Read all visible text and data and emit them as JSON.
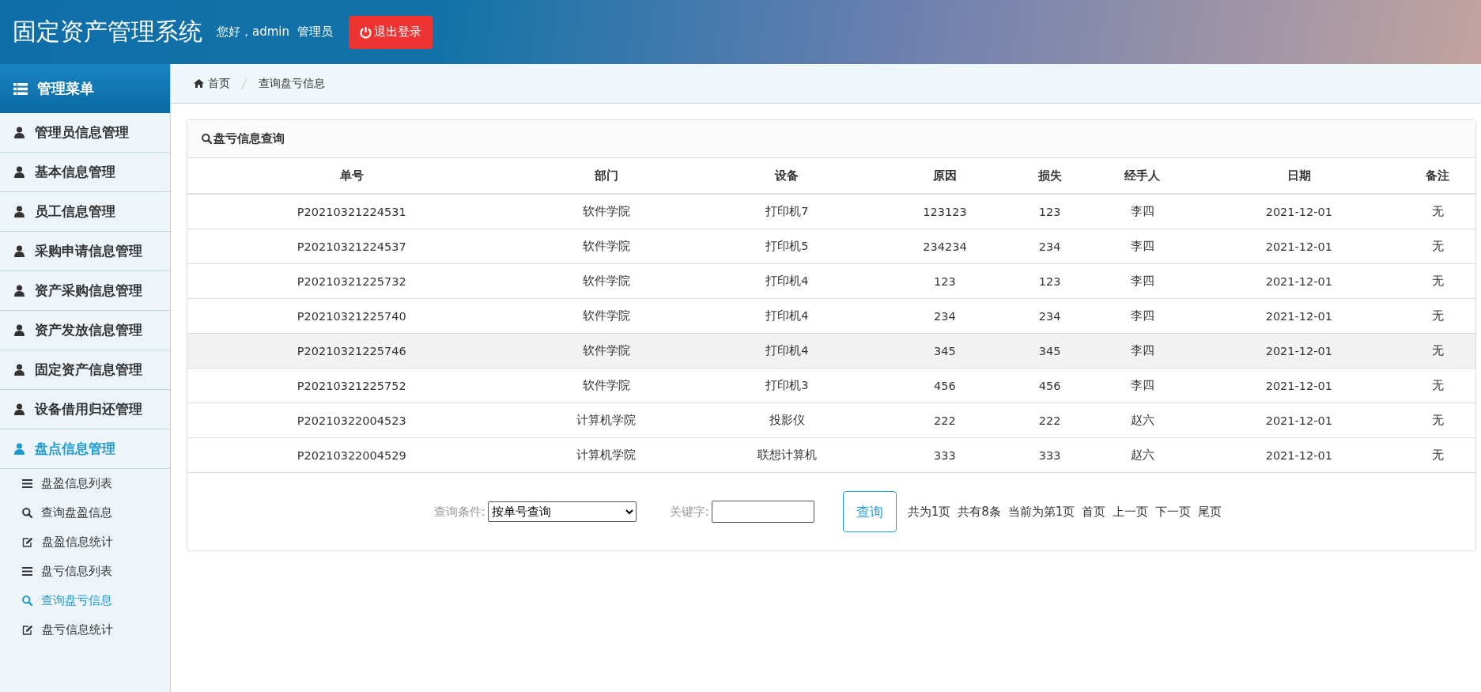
{
  "header": {
    "title": "固定资产管理系统",
    "greeting": "您好，admin  管理员",
    "logout_button": "退出登录"
  },
  "sidebar": {
    "title": "管理菜单",
    "items": [
      {
        "label": "管理员信息管理",
        "expanded": false
      },
      {
        "label": "基本信息管理",
        "expanded": false
      },
      {
        "label": "员工信息管理",
        "expanded": false
      },
      {
        "label": "采购申请信息管理",
        "expanded": false
      },
      {
        "label": "资产采购信息管理",
        "expanded": false
      },
      {
        "label": "资产发放信息管理",
        "expanded": false
      },
      {
        "label": "固定资产信息管理",
        "expanded": false
      },
      {
        "label": "设备借用归还管理",
        "expanded": false
      },
      {
        "label": "盘点信息管理",
        "expanded": true,
        "children": [
          {
            "label": "盘盈信息列表",
            "kind": "list",
            "selected": false
          },
          {
            "label": "查询盘盈信息",
            "kind": "search",
            "selected": false
          },
          {
            "label": "盘盈信息统计",
            "kind": "edit",
            "selected": false
          },
          {
            "label": "盘亏信息列表",
            "kind": "list",
            "selected": false
          },
          {
            "label": "查询盘亏信息",
            "kind": "search",
            "selected": true
          },
          {
            "label": "盘亏信息统计",
            "kind": "edit",
            "selected": false
          }
        ]
      }
    ]
  },
  "breadcrumb": [
    "首页",
    "查询盘亏信息"
  ],
  "panel": {
    "title": "盘亏信息查询",
    "table": {
      "columns": [
        "单号",
        "部门",
        "设备",
        "原因",
        "损失",
        "经手人",
        "日期",
        "备注"
      ],
      "rows": [
        {
          "highlighted": false,
          "cells": [
            "P20210321224531",
            "软件学院",
            "打印机7",
            "123123",
            "123",
            "李四",
            "2021-12-01",
            "无"
          ]
        },
        {
          "highlighted": false,
          "cells": [
            "P20210321224537",
            "软件学院",
            "打印机5",
            "234234",
            "234",
            "李四",
            "2021-12-01",
            "无"
          ]
        },
        {
          "highlighted": false,
          "cells": [
            "P20210321225732",
            "软件学院",
            "打印机4",
            "123",
            "123",
            "李四",
            "2021-12-01",
            "无"
          ]
        },
        {
          "highlighted": false,
          "cells": [
            "P20210321225740",
            "软件学院",
            "打印机4",
            "234",
            "234",
            "李四",
            "2021-12-01",
            "无"
          ]
        },
        {
          "highlighted": true,
          "cells": [
            "P20210321225746",
            "软件学院",
            "打印机4",
            "345",
            "345",
            "李四",
            "2021-12-01",
            "无"
          ]
        },
        {
          "highlighted": false,
          "cells": [
            "P20210321225752",
            "软件学院",
            "打印机3",
            "456",
            "456",
            "李四",
            "2021-12-01",
            "无"
          ]
        },
        {
          "highlighted": false,
          "cells": [
            "P20210322004523",
            "计算机学院",
            "投影仪",
            "222",
            "222",
            "赵六",
            "2021-12-01",
            "无"
          ]
        },
        {
          "highlighted": false,
          "cells": [
            "P20210322004529",
            "计算机学院",
            "联想计算机",
            "333",
            "333",
            "赵六",
            "2021-12-01",
            "无"
          ]
        }
      ]
    },
    "search": {
      "condition_label": "查询条件:",
      "condition_value": "按单号查询",
      "keyword_label": "关键字:",
      "button": "查询"
    },
    "pagination": {
      "info": [
        "共为1页",
        "共有8条",
        "当前为第1页"
      ],
      "links": [
        "首页",
        "上一页",
        "下一页",
        "尾页"
      ]
    }
  }
}
